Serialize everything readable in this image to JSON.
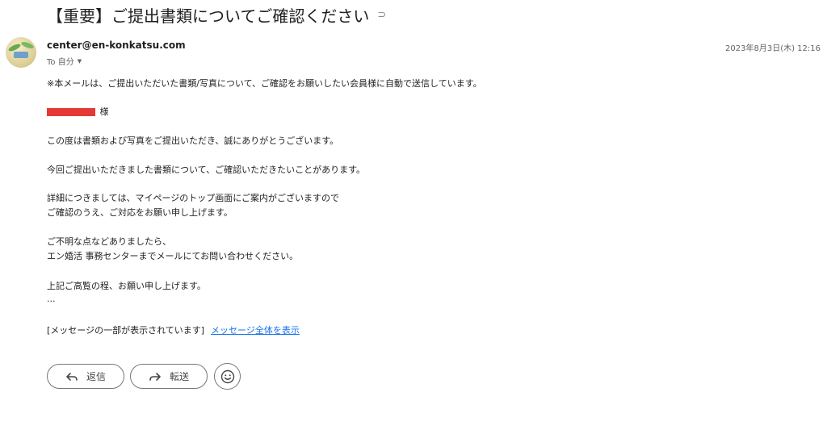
{
  "email": {
    "subject": "【重要】ご提出書類についてご確認ください",
    "subject_icon": "label-icon",
    "sender": "center@en-konkatsu.com",
    "recipient": "To 自分",
    "date": "2023年8月3日(木) 12:16"
  },
  "body": {
    "line1": "※本メールは、ご提出いただいた書類/写真について、ご確認をお願いしたい会員様に自動で送信しています。",
    "honorific": "様",
    "line2": "この度は書類および写真をご提出いただき、誠にありがとうございます。",
    "line3": "今回ご提出いただきました書類について、ご確認いただきたいことがあります。",
    "line4": "詳細につきましては、マイページのトップ画面にご案内がございますので",
    "line5": "ご確認のうえ、ご対応をお願い申し上げます。",
    "line6": "ご不明な点などありましたら、",
    "line7": "エン婚活 事務センターまでメールにてお問い合わせください。",
    "line8": "上記ご高覧の程、お願い申し上げます。",
    "ellipsis": "..."
  },
  "truncated": {
    "notice": "[メッセージの一部が表示されています]",
    "link": "メッセージ全体を表示"
  },
  "actions": {
    "reply_label": "返信",
    "forward_label": "転送"
  },
  "colors": {
    "redaction": "#e53935",
    "link": "#1a73e8",
    "button_border": "#747775"
  }
}
